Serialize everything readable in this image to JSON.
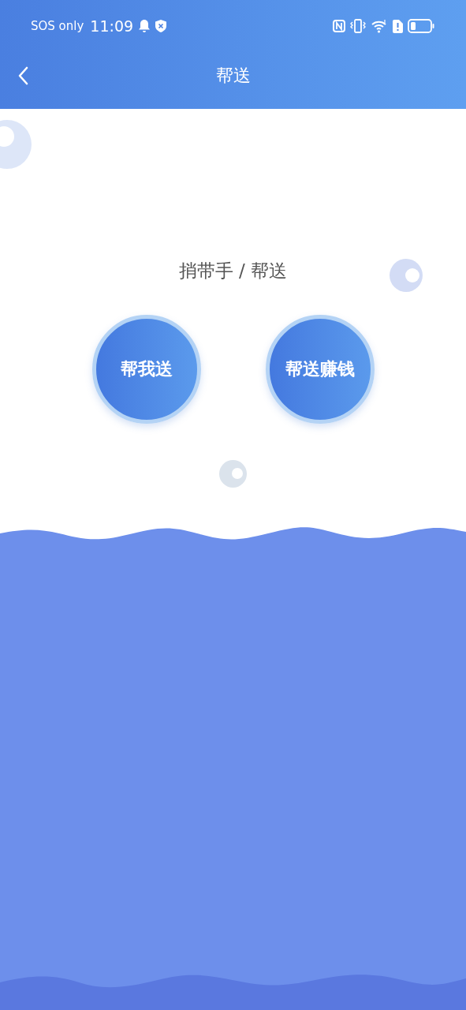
{
  "status_bar": {
    "carrier": "SOS only",
    "time": "11:09"
  },
  "header": {
    "title": "帮送"
  },
  "subtitle": "捎带手 / 帮送",
  "buttons": [
    {
      "label": "帮我送"
    },
    {
      "label": "帮送赚钱"
    }
  ]
}
